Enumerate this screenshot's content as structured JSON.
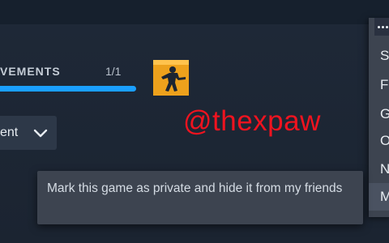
{
  "achievements": {
    "title": "VEMENTS",
    "count": "1/1",
    "progress_percent": 100
  },
  "game": {
    "logo_icon": "counter-strike-logo"
  },
  "dropdown": {
    "label": "ent",
    "icon": "chevron-down-icon"
  },
  "watermark": {
    "text": "@thexpaw"
  },
  "context_menu": {
    "dots_icon": "more-options-icon",
    "items": [
      {
        "label": "S"
      },
      {
        "label": "F"
      },
      {
        "label": "G"
      },
      {
        "label": "O"
      },
      {
        "label": "N"
      },
      {
        "label": "M"
      }
    ]
  },
  "tooltip": {
    "text": "Mark this game as private and hide it from my friends"
  },
  "colors": {
    "background": "#1c2533",
    "progress": "#1a9fff",
    "tooltip_bg": "#3d4450",
    "watermark": "#f0131f",
    "logo_bg": "#eda11c"
  }
}
